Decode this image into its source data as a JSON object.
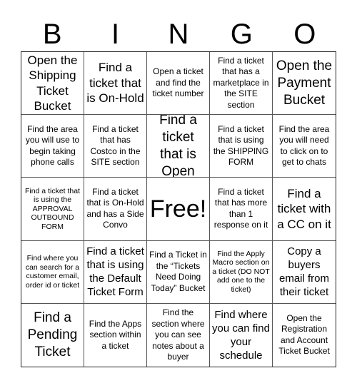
{
  "header": {
    "letters": [
      "B",
      "I",
      "N",
      "G",
      "O"
    ]
  },
  "grid": {
    "rows": [
      [
        "Open the Shipping Ticket Bucket",
        "Find a ticket that is On-Hold",
        "Open a ticket and find the ticket number",
        "Find a ticket that has a marketplace in the SITE section",
        "Open the Payment Bucket"
      ],
      [
        "Find the area you will use to begin taking phone calls",
        "Find a ticket that has Costco in the SITE section",
        "Find a ticket that is Open",
        "Find a ticket that is using the SHIPPING FORM",
        "Find the area you will need to click on to get to chats"
      ],
      [
        "Find a ticket that is using the APPROVAL OUTBOUND FORM",
        "Find a ticket that is On-Hold and has a Side Convo",
        "Free!",
        "Find a ticket that has more than 1 response on it",
        "Find a ticket with a CC on it"
      ],
      [
        "Find where you can search for a customer email, order id or ticket",
        "Find a ticket that is using the Default Ticket Form",
        "Find a Ticket in the “Tickets Need Doing Today” Bucket",
        "Find the Apply Macro section on a ticket (DO NOT add one to the ticket)",
        "Copy a buyers email from their ticket"
      ],
      [
        "Find a Pending Ticket",
        "Find the Apps section within a ticket",
        "Find the section where you can see notes about a buyer",
        "Find where you can find your schedule",
        "Open the Registration and Account Ticket Bucket"
      ]
    ]
  }
}
